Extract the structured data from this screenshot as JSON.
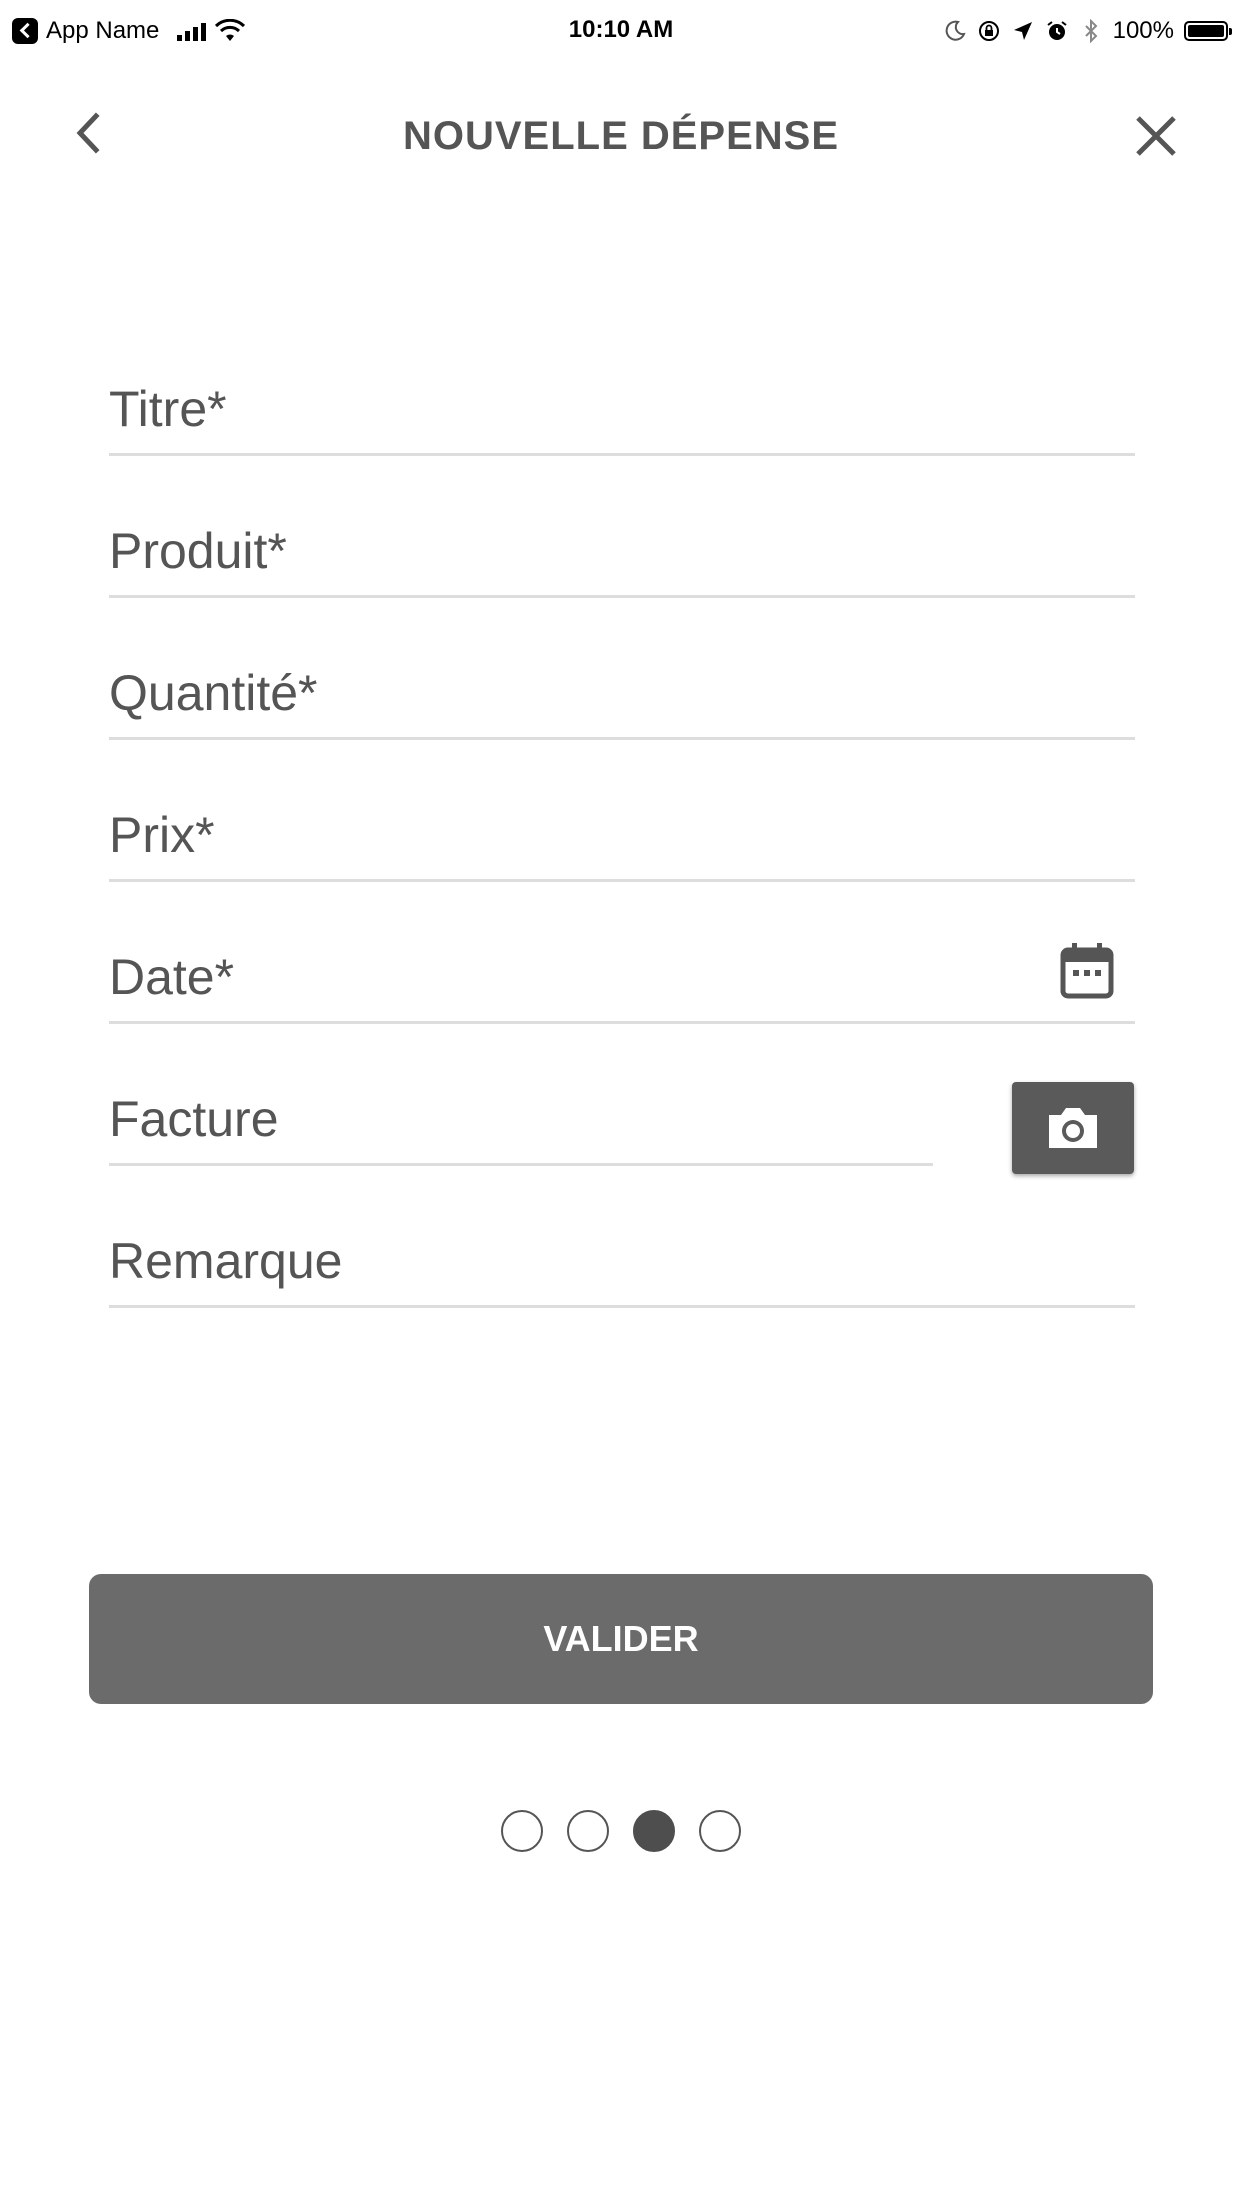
{
  "status_bar": {
    "app_name": "App Name",
    "time": "10:10 AM",
    "battery": "100%"
  },
  "header": {
    "title": "NOUVELLE DÉPENSE"
  },
  "form": {
    "titre": {
      "placeholder": "Titre*",
      "value": ""
    },
    "produit": {
      "placeholder": "Produit*",
      "value": ""
    },
    "quantite": {
      "placeholder": "Quantité*",
      "value": ""
    },
    "prix": {
      "placeholder": "Prix*",
      "value": ""
    },
    "date": {
      "placeholder": "Date*",
      "value": ""
    },
    "facture": {
      "placeholder": "Facture",
      "value": ""
    },
    "remarque": {
      "placeholder": "Remarque",
      "value": ""
    }
  },
  "actions": {
    "submit_label": "VALIDER"
  },
  "pager": {
    "total": 4,
    "active_index": 2
  },
  "icons": {
    "back": "chevron-left-icon",
    "close": "close-icon",
    "date": "calendar-icon",
    "facture": "camera-icon"
  },
  "colors": {
    "text": "#555555",
    "button": "#6b6b6b",
    "camera_button": "#5a5a5a",
    "divider": "#dddddd"
  }
}
